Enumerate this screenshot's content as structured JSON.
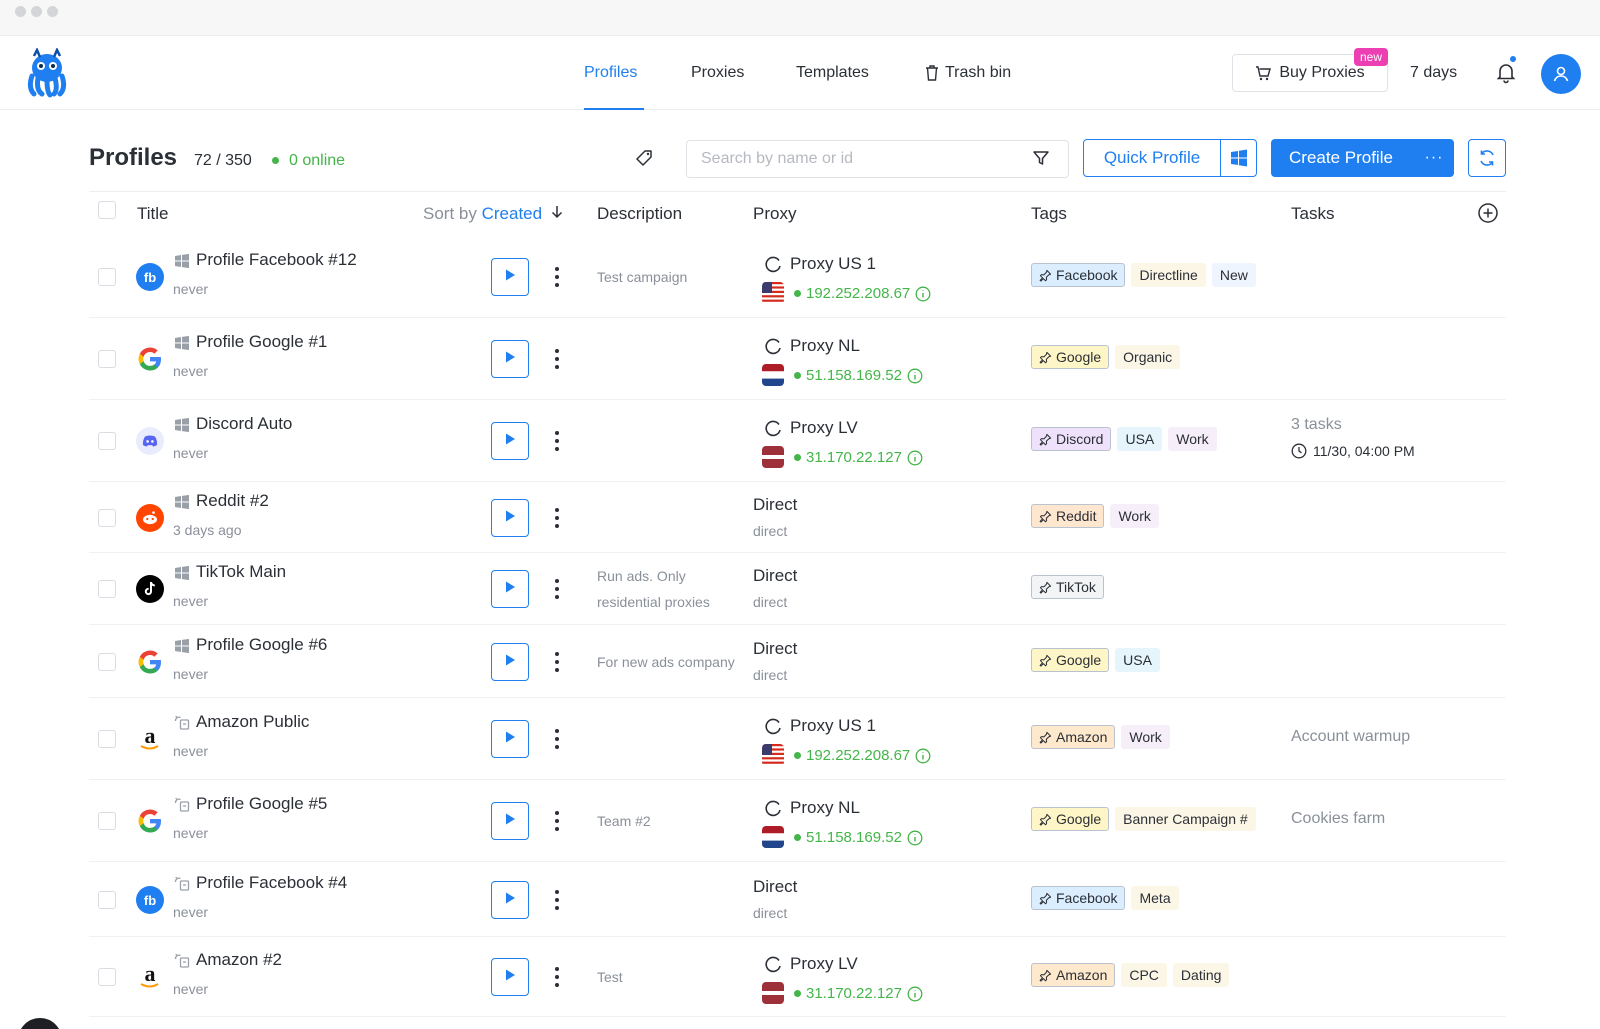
{
  "nav": {
    "tabs": [
      {
        "label": "Profiles"
      },
      {
        "label": "Proxies"
      },
      {
        "label": "Templates"
      },
      {
        "label": "Trash bin"
      }
    ],
    "active_tab": "Profiles",
    "buy_proxies_label": "Buy Proxies",
    "new_badge": "new",
    "days_left": "7 days"
  },
  "toolbar": {
    "title": "Profiles",
    "count": "72 / 350",
    "online": "0 online",
    "search_placeholder": "Search by name or id",
    "quick_profile_label": "Quick Profile",
    "create_profile_label": "Create Profile",
    "create_more_label": "···"
  },
  "table": {
    "headers": {
      "title": "Title",
      "sort_by": "Sort by",
      "sort_key": "Created",
      "description": "Description",
      "proxy": "Proxy",
      "tags": "Tags",
      "tasks": "Tasks"
    },
    "rows": [
      {
        "site_icon": "facebook-icon",
        "os_icon": "windows-icon",
        "name": "Profile Facebook #12",
        "last_launch": "never",
        "description": "Test campaign",
        "proxy_type": "proxy",
        "proxy_name": "Proxy US 1",
        "flag": "us",
        "ip": "192.252.208.67",
        "tags": [
          {
            "label": "Facebook",
            "pinned": true,
            "color": "#dbeeff"
          },
          {
            "label": "Directline",
            "pinned": false,
            "color": "#fbf6e6"
          },
          {
            "label": "New",
            "pinned": false,
            "color": "#eef5ff"
          }
        ],
        "task_main": "",
        "task_sub": ""
      },
      {
        "site_icon": "google-icon",
        "os_icon": "windows-icon",
        "name": "Profile Google #1",
        "last_launch": "never",
        "description": "",
        "proxy_type": "proxy",
        "proxy_name": "Proxy NL",
        "flag": "nl",
        "ip": "51.158.169.52",
        "tags": [
          {
            "label": "Google",
            "pinned": true,
            "color": "#fff6c7"
          },
          {
            "label": "Organic",
            "pinned": false,
            "color": "#fbf6e6"
          }
        ],
        "task_main": "",
        "task_sub": ""
      },
      {
        "site_icon": "discord-icon",
        "os_icon": "windows-icon",
        "name": "Discord Auto",
        "last_launch": "never",
        "description": "",
        "proxy_type": "proxy",
        "proxy_name": "Proxy LV",
        "flag": "lv",
        "ip": "31.170.22.127",
        "tags": [
          {
            "label": "Discord",
            "pinned": true,
            "color": "#efe1fb"
          },
          {
            "label": "USA",
            "pinned": false,
            "color": "#e6f4fb"
          },
          {
            "label": "Work",
            "pinned": false,
            "color": "#f6effa"
          }
        ],
        "task_main": "3 tasks",
        "task_sub": "11/30, 04:00 PM"
      },
      {
        "site_icon": "reddit-icon",
        "os_icon": "windows-icon",
        "name": "Reddit #2",
        "last_launch": "3 days ago",
        "description": "",
        "proxy_type": "direct",
        "proxy_name": "Direct",
        "proxy_sub": "direct",
        "tags": [
          {
            "label": "Reddit",
            "pinned": true,
            "color": "#ffe6cf"
          },
          {
            "label": "Work",
            "pinned": false,
            "color": "#f6effa"
          }
        ],
        "task_main": "",
        "task_sub": ""
      },
      {
        "site_icon": "tiktok-icon",
        "os_icon": "windows-icon",
        "name": "TikTok Main",
        "last_launch": "never",
        "description": "Run ads. Only residential proxies",
        "proxy_type": "direct",
        "proxy_name": "Direct",
        "proxy_sub": "direct",
        "tags": [
          {
            "label": "TikTok",
            "pinned": true,
            "color": "#f3f4f6"
          }
        ],
        "task_main": "",
        "task_sub": ""
      },
      {
        "site_icon": "google-icon",
        "os_icon": "windows-icon",
        "name": "Profile Google #6",
        "last_launch": "never",
        "description": "For new ads company",
        "proxy_type": "direct",
        "proxy_name": "Direct",
        "proxy_sub": "direct",
        "tags": [
          {
            "label": "Google",
            "pinned": true,
            "color": "#fff6c7"
          },
          {
            "label": "USA",
            "pinned": false,
            "color": "#e6f4fb"
          }
        ],
        "task_main": "",
        "task_sub": ""
      },
      {
        "site_icon": "amazon-icon",
        "os_icon": "android-icon",
        "name": "Amazon Public",
        "last_launch": "never",
        "description": "",
        "proxy_type": "proxy",
        "proxy_name": "Proxy US 1",
        "flag": "us",
        "ip": "192.252.208.67",
        "tags": [
          {
            "label": "Amazon",
            "pinned": true,
            "color": "#ffe9cc"
          },
          {
            "label": "Work",
            "pinned": false,
            "color": "#f6effa"
          }
        ],
        "task_main": "Account warmup",
        "task_sub": ""
      },
      {
        "site_icon": "google-icon",
        "os_icon": "android-icon",
        "name": "Profile Google #5",
        "last_launch": "never",
        "description": "Team #2",
        "proxy_type": "proxy",
        "proxy_name": "Proxy NL",
        "flag": "nl",
        "ip": "51.158.169.52",
        "tags": [
          {
            "label": "Google",
            "pinned": true,
            "color": "#fff6c7"
          },
          {
            "label": "Banner Campaign #",
            "pinned": false,
            "color": "#fbf6e6"
          }
        ],
        "task_main": "Cookies farm",
        "task_sub": ""
      },
      {
        "site_icon": "facebook-icon",
        "os_icon": "android-icon",
        "name": "Profile Facebook #4",
        "last_launch": "never",
        "description": "",
        "proxy_type": "direct",
        "proxy_name": "Direct",
        "proxy_sub": "direct",
        "tags": [
          {
            "label": "Facebook",
            "pinned": true,
            "color": "#dbeeff"
          },
          {
            "label": "Meta",
            "pinned": false,
            "color": "#fbf6e6"
          }
        ],
        "task_main": "",
        "task_sub": ""
      },
      {
        "site_icon": "amazon-icon",
        "os_icon": "android-icon",
        "name": "Amazon #2",
        "last_launch": "never",
        "description": "Test",
        "proxy_type": "proxy",
        "proxy_name": "Proxy LV",
        "flag": "lv",
        "ip": "31.170.22.127",
        "tags": [
          {
            "label": "Amazon",
            "pinned": true,
            "color": "#ffe9cc"
          },
          {
            "label": "CPC",
            "pinned": false,
            "color": "#fbf6e6"
          },
          {
            "label": "Dating",
            "pinned": false,
            "color": "#fbf6e6"
          }
        ],
        "task_main": "",
        "task_sub": ""
      }
    ]
  },
  "colors": {
    "accent": "#1f7ff0",
    "online": "#44b549",
    "new_badge": "#ec3fb1",
    "muted": "#8a9099"
  }
}
